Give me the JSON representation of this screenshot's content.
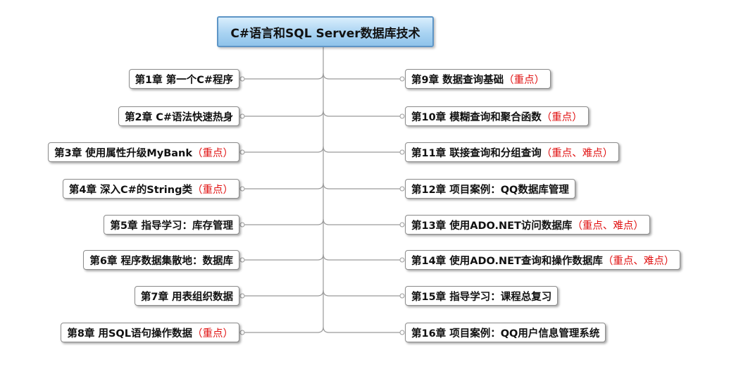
{
  "root": {
    "label": "C#语言和SQL Server数据库技术"
  },
  "left_chapters": [
    {
      "title": "第1章 第一个C#程序",
      "highlight": ""
    },
    {
      "title": "第2章 C#语法快速热身",
      "highlight": ""
    },
    {
      "title": "第3章 使用属性升级MyBank",
      "highlight": "（重点）"
    },
    {
      "title": "第4章 深入C#的String类",
      "highlight": "（重点）"
    },
    {
      "title": "第5章 指导学习：库存管理",
      "highlight": ""
    },
    {
      "title": "第6章 程序数据集散地：数据库",
      "highlight": ""
    },
    {
      "title": "第7章 用表组织数据",
      "highlight": ""
    },
    {
      "title": "第8章 用SQL语句操作数据",
      "highlight": "（重点）"
    }
  ],
  "right_chapters": [
    {
      "title": "第9章 数据查询基础",
      "highlight": "（重点）"
    },
    {
      "title": "第10章 模糊查询和聚合函数",
      "highlight": "（重点）"
    },
    {
      "title": "第11章 联接查询和分组查询",
      "highlight": "（重点、难点）"
    },
    {
      "title": "第12章 项目案例：QQ数据库管理",
      "highlight": ""
    },
    {
      "title": "第13章 使用ADO.NET访问数据库",
      "highlight": "（重点、难点）"
    },
    {
      "title": "第14章 使用ADO.NET查询和操作数据库",
      "highlight": "（重点、难点）"
    },
    {
      "title": "第15章 指导学习：课程总复习",
      "highlight": ""
    },
    {
      "title": "第16章 项目案例：QQ用户信息管理系统",
      "highlight": ""
    }
  ],
  "colors": {
    "line": "#9a9a9a",
    "highlight": "#e01010",
    "root_border": "#5d95c6"
  }
}
